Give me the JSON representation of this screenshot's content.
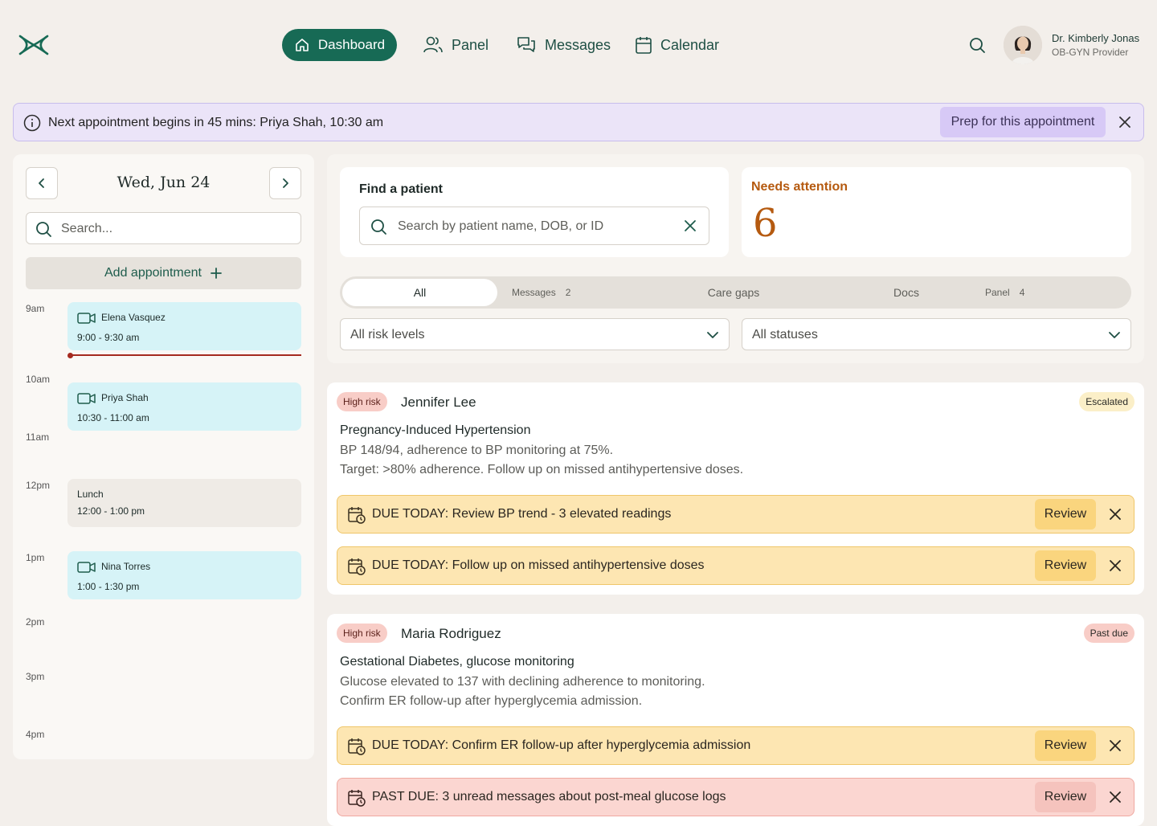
{
  "nav": {
    "items": [
      {
        "label": "Dashboard",
        "icon": "home-icon"
      },
      {
        "label": "Panel",
        "icon": "users-icon"
      },
      {
        "label": "Messages",
        "icon": "chat-icon"
      },
      {
        "label": "Calendar",
        "icon": "calendar-icon"
      }
    ],
    "active": "Dashboard"
  },
  "user": {
    "name": "Dr. Kimberly Jonas",
    "role": "OB-GYN Provider"
  },
  "banner": {
    "text": "Next appointment begins in 45 mins: Priya Shah, 10:30 am",
    "action": "Prep for this appointment"
  },
  "schedule": {
    "date": "Wed, Jun 24",
    "search_placeholder": "Search...",
    "add_label": "Add appointment",
    "times": [
      "9am",
      "10am",
      "11am",
      "12pm",
      "1pm",
      "2pm",
      "3pm",
      "4pm"
    ],
    "appointments": [
      {
        "name": "Elena Vasquez",
        "time": "9:00 - 9:30 am",
        "type": "video"
      },
      {
        "name": "Priya Shah",
        "time": "10:30 - 11:00 am",
        "type": "video"
      },
      {
        "name": "Lunch",
        "time": "12:00 - 1:00 pm",
        "type": "break"
      },
      {
        "name": "Nina Torres",
        "time": "1:00 - 1:30 pm",
        "type": "video"
      }
    ]
  },
  "find": {
    "title": "Find a patient",
    "placeholder": "Search by patient name, DOB, or ID"
  },
  "attention": {
    "title": "Needs attention",
    "count": "6"
  },
  "tabs": [
    {
      "label": "All",
      "count": ""
    },
    {
      "label": "Messages",
      "count": "2"
    },
    {
      "label": "Care gaps",
      "count": ""
    },
    {
      "label": "Docs",
      "count": ""
    },
    {
      "label": "Panel",
      "count": "4"
    }
  ],
  "filters": {
    "risk": "All risk levels",
    "status": "All statuses"
  },
  "patients": [
    {
      "risk": "High risk",
      "name": "Jennifer Lee",
      "status": "Escalated",
      "condition": "Pregnancy-Induced Hypertension",
      "desc1": "BP 148/94, adherence to BP monitoring at 75%.",
      "desc2": "Target: >80% adherence. Follow up on missed antihypertensive doses.",
      "tasks": [
        {
          "text": "DUE TODAY: Review BP trend - 3 elevated readings",
          "action": "Review"
        },
        {
          "text": "DUE TODAY: Follow up on missed antihypertensive doses",
          "action": "Review"
        }
      ]
    },
    {
      "risk": "High risk",
      "name": "Maria Rodriguez",
      "status": "Past due",
      "condition": "Gestational Diabetes, glucose monitoring",
      "desc1": "Glucose elevated to 137 with declining adherence to monitoring.",
      "desc2": "Confirm ER follow-up after hyperglycemia admission.",
      "tasks": [
        {
          "text": "DUE TODAY: Confirm ER follow-up after hyperglycemia admission",
          "action": "Review"
        },
        {
          "text": "PAST DUE: 3 unread messages about post-meal glucose logs",
          "action": "Review"
        }
      ]
    }
  ],
  "colors": {
    "brand": "#176a55",
    "banner": "#ebe4f8",
    "attention": "#b55a10",
    "due_today": "#fde6b2",
    "past_due": "#fbd6d1"
  }
}
